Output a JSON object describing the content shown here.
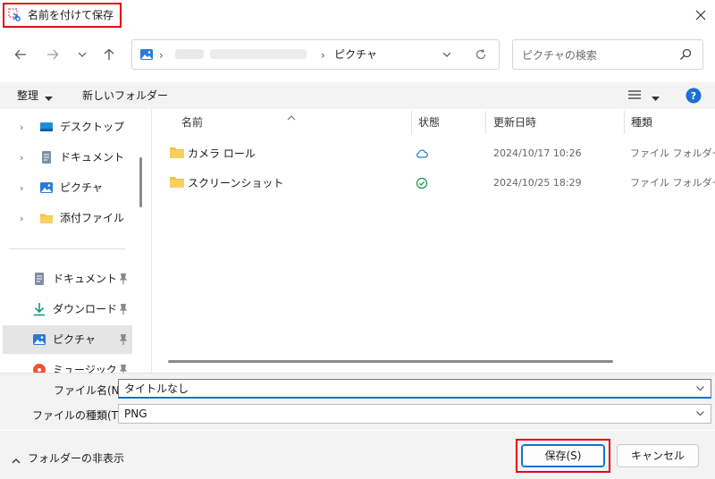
{
  "window": {
    "title": "名前を付けて保存",
    "icons": {
      "app": "snipping-tool-icon",
      "close": "close-icon"
    }
  },
  "address": {
    "current_folder": "ピクチャ",
    "refresh_icon": "refresh-icon",
    "dropdown_icon": "chevron-down-icon"
  },
  "search": {
    "placeholder": "ピクチャの検索"
  },
  "toolbar": {
    "organize_label": "整理",
    "new_folder_label": "新しいフォルダー"
  },
  "nav": {
    "tree": [
      {
        "label": "デスクトップ",
        "icon": "desktop-icon"
      },
      {
        "label": "ドキュメント",
        "icon": "document-icon"
      },
      {
        "label": "ピクチャ",
        "icon": "pictures-icon"
      },
      {
        "label": "添付ファイル",
        "icon": "folder-icon"
      }
    ],
    "quick": [
      {
        "label": "ドキュメント",
        "icon": "document-icon",
        "pinned": true
      },
      {
        "label": "ダウンロード",
        "icon": "download-icon",
        "pinned": true
      },
      {
        "label": "ピクチャ",
        "icon": "pictures-icon",
        "pinned": true,
        "selected": true
      },
      {
        "label": "ミュージック",
        "icon": "music-icon",
        "pinned": true
      }
    ]
  },
  "list": {
    "columns": [
      "名前",
      "状態",
      "更新日時",
      "種類"
    ],
    "rows": [
      {
        "name": "カメラ ロール",
        "status": "cloud-icon",
        "date": "2024/10/17 10:26",
        "type": "ファイル フォルダー"
      },
      {
        "name": "スクリーンショット",
        "status": "check-circle-icon",
        "date": "2024/10/25 18:29",
        "type": "ファイル フォルダー"
      }
    ]
  },
  "form": {
    "filename_label": "ファイル名(N):",
    "filename_value": "タイトルなし",
    "filetype_label": "ファイルの種類(T):",
    "filetype_value": "PNG"
  },
  "footer": {
    "toggle_label": "フォルダーの非表示",
    "save_label": "保存(S)",
    "cancel_label": "キャンセル"
  },
  "colors": {
    "highlight": "#e60012",
    "accent": "#1a6fd1",
    "folder": "#f4c244"
  }
}
